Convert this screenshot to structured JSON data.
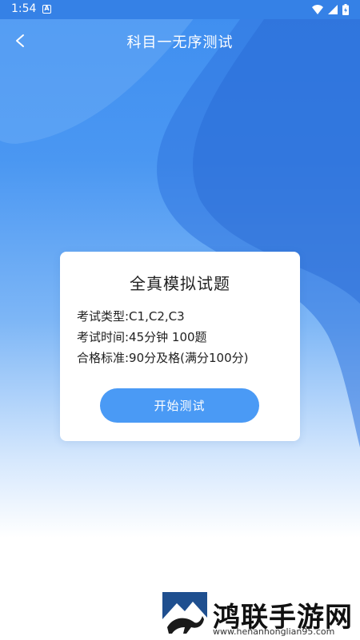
{
  "status_bar": {
    "time": "1:54",
    "icons": [
      "a-icon",
      "wifi-icon",
      "signal-icon",
      "battery-icon"
    ]
  },
  "header": {
    "back_icon": "back-arrow-icon",
    "title": "科目一无序测试"
  },
  "card": {
    "title": "全真模拟试题",
    "exam_type": "考试类型:C1,C2,C3",
    "exam_time": "考试时间:45分钟 100题",
    "pass_standard": "合格标准:90分及格(满分100分)",
    "start_button": "开始测试"
  },
  "watermark": {
    "name": "鸿联手游网",
    "url": "www.henanhonglian95.com"
  },
  "colors": {
    "primary": "#3f8ef0",
    "button": "#4a9af5",
    "card_bg": "#ffffff"
  }
}
